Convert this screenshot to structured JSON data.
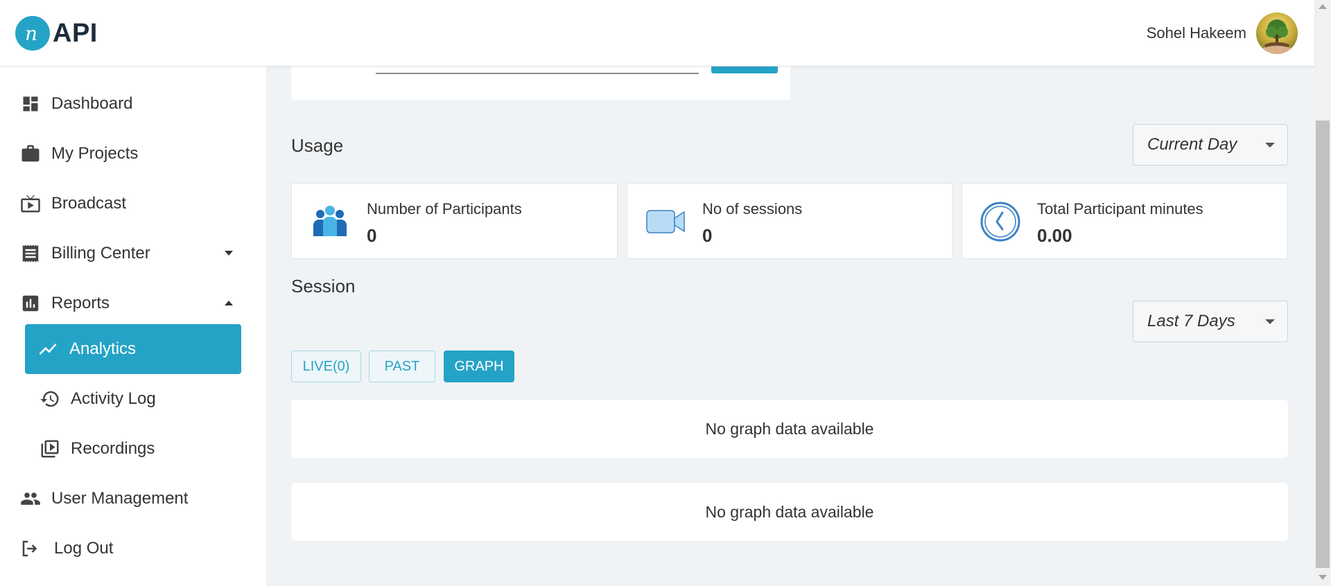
{
  "app": {
    "logo_text": "API",
    "logo_icon": "n-logo-icon",
    "user_name": "Sohel Hakeem",
    "brand_color": "#25a3c6"
  },
  "sidebar": {
    "items": [
      {
        "label": "Dashboard",
        "icon": "dashboard-icon"
      },
      {
        "label": "My Projects",
        "icon": "briefcase-icon"
      },
      {
        "label": "Broadcast",
        "icon": "tv-play-icon"
      },
      {
        "label": "Billing Center",
        "icon": "receipt-icon",
        "expanded": false
      },
      {
        "label": "Reports",
        "icon": "bar-chart-icon",
        "expanded": true
      },
      {
        "label": "User Management",
        "icon": "people-icon"
      },
      {
        "label": "Log Out",
        "icon": "logout-icon"
      }
    ],
    "reports_children": [
      {
        "label": "Analytics",
        "icon": "trending-icon",
        "active": true
      },
      {
        "label": "Activity Log",
        "icon": "history-icon"
      },
      {
        "label": "Recordings",
        "icon": "video-library-icon"
      }
    ]
  },
  "usage": {
    "title": "Usage",
    "period_selected": "Current Day",
    "stats": [
      {
        "label": "Number of Participants",
        "value": "0",
        "icon": "participants-icon"
      },
      {
        "label": "No of sessions",
        "value": "0",
        "icon": "video-camera-icon"
      },
      {
        "label": "Total Participant minutes",
        "value": "0.00",
        "icon": "clock-icon"
      }
    ]
  },
  "session": {
    "title": "Session",
    "period_selected": "Last 7 Days",
    "tabs": [
      {
        "label": "LIVE(0)",
        "active": false
      },
      {
        "label": "PAST",
        "active": false
      },
      {
        "label": "GRAPH",
        "active": true
      }
    ],
    "graphs": [
      {
        "empty_text": "No graph data available"
      },
      {
        "empty_text": "No graph data available"
      }
    ]
  }
}
